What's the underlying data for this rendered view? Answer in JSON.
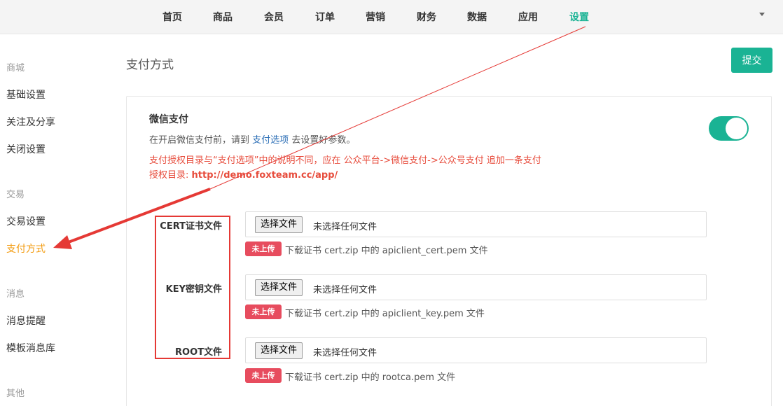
{
  "nav": {
    "items": [
      "首页",
      "商品",
      "会员",
      "订单",
      "营销",
      "财务",
      "数据",
      "应用",
      "设置"
    ],
    "active": "设置"
  },
  "sidebar": {
    "groups": [
      {
        "label": "商城",
        "links": [
          "基础设置",
          "关注及分享",
          "关闭设置"
        ]
      },
      {
        "label": "交易",
        "links": [
          "交易设置",
          "支付方式"
        ]
      },
      {
        "label": "消息",
        "links": [
          "消息提醒",
          "模板消息库"
        ]
      },
      {
        "label": "其他",
        "links": []
      }
    ],
    "active": "支付方式"
  },
  "main": {
    "title": "支付方式",
    "submit_label": "提交"
  },
  "wechat": {
    "title": "微信支付",
    "desc_before": "在开启微信支付前，请到",
    "desc_link": "支付选项",
    "desc_after": "去设置好参数。",
    "warn_line1": "支付授权目录与“支付选项”中的说明不同，应在 公众平台->微信支付->公众号支付 追加一条支付",
    "warn_line2_prefix": "授权目录: ",
    "warn_url": "http://demo.foxteam.cc/app/",
    "enabled": true
  },
  "files": [
    {
      "label": "CERT证书文件",
      "button": "选择文件",
      "status": "未选择任何文件",
      "badge": "未上传",
      "hint": "下载证书 cert.zip 中的 apiclient_cert.pem 文件"
    },
    {
      "label": "KEY密钥文件",
      "button": "选择文件",
      "status": "未选择任何文件",
      "badge": "未上传",
      "hint": "下载证书 cert.zip 中的 apiclient_key.pem 文件"
    },
    {
      "label": "ROOT文件",
      "button": "选择文件",
      "status": "未选择任何文件",
      "badge": "未上传",
      "hint": "下载证书 cert.zip 中的 rootca.pem 文件"
    }
  ],
  "colors": {
    "accent": "#1ab394",
    "active_sidebar": "#f39c12",
    "warning": "#e74c3c",
    "badge": "#e74c5e",
    "annotation": "#e53935"
  }
}
